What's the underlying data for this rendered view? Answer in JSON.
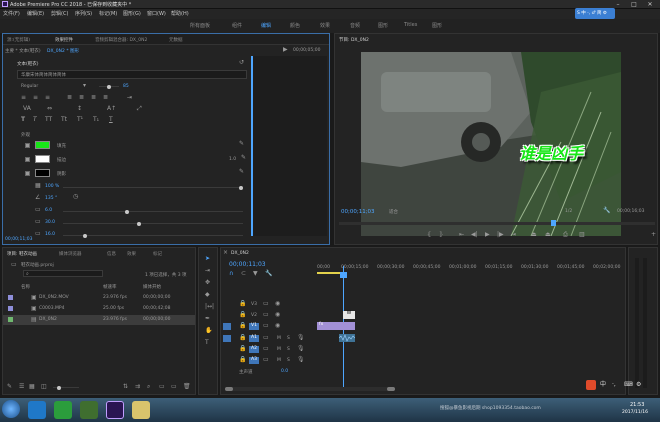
{
  "app": {
    "title": "Adobe Premiere Pro CC 2018 - 已保存到收藏夹中 *"
  },
  "menu": [
    "文件(F)",
    "编辑(E)",
    "剪辑(C)",
    "序列(S)",
    "标记(M)",
    "图形(G)",
    "窗口(W)",
    "帮助(H)"
  ],
  "workspaces": [
    "所有面板",
    "组件",
    "编辑",
    "颜色",
    "效果",
    "音频",
    "图形",
    "Titles",
    "图形"
  ],
  "effect_controls": {
    "tabs": [
      "源:(无剪辑)",
      "效果控件",
      "音频剪辑混合器: DX_0N2",
      "元数据"
    ],
    "master_label": "主要 * 文本(鞋衣)",
    "clip_label": "DX_0N2 * 图形",
    "time": "00;00;05;00",
    "text_section": "文本(鞋衣)",
    "font_name": "华康宋体简体简体简体",
    "font_style": "Regular",
    "font_size": "85",
    "appearance_label": "外观",
    "fill_label": "填充",
    "stroke_label": "描边",
    "shadow_label": "阴影",
    "stroke_value": "1.0",
    "shadow_values": [
      "100 %",
      "135 °",
      "6.0",
      "30.0",
      "16.0"
    ],
    "timecode": "00;00;11;03",
    "fill_color": "#17e617",
    "stroke_color": "#ffffff",
    "shadow_color": "#000000"
  },
  "program_monitor": {
    "title": "节目: DX_0N2",
    "timecode_left": "00;00;11;03",
    "fit_label": "适合",
    "ratio_label": "1/2",
    "timecode_right": "00;00;16;03",
    "overlay_text": "谁是凶手"
  },
  "project": {
    "tabs": [
      "项目: 鞋衣动画",
      "媒体浏览器",
      "信息",
      "效果",
      "标记"
    ],
    "path": "鞋衣动画.prproj",
    "items_count": "1 项已选择，共 3 项",
    "columns": [
      "名称",
      "帧速率",
      "媒体开始"
    ],
    "items": [
      {
        "name": "DX_0N2.MOV",
        "fps": "23.976 fps",
        "start": "00;00;00;00",
        "color": "#8e8ed9"
      },
      {
        "name": "C0003.MP4",
        "fps": "25.00 fps",
        "start": "00;00;42;08",
        "color": "#8e8ed9"
      },
      {
        "name": "DX_0N2",
        "fps": "23.976 fps",
        "start": "00;00;00;00",
        "color": "#6fb86f"
      }
    ]
  },
  "timeline": {
    "title": "DX_0N2",
    "timecode": "00;00;11;03",
    "ruler": [
      "00;00",
      "00;00;15;00",
      "00;00;30;00",
      "00;00;45;00",
      "00;01;00;00",
      "00;01;15;00",
      "00;01;30;00",
      "00;01;45;00",
      "00;02;00;00"
    ],
    "video_tracks": [
      "V3",
      "V2",
      "V1"
    ],
    "audio_tracks": [
      "A1",
      "A2",
      "A3"
    ],
    "master_label": "主声道",
    "master_value": "0.0",
    "clip_v1_label": "fx",
    "clip_v2_label": "W"
  },
  "taskbar": {
    "clock_time": "21:53",
    "clock_date": "2017/11/16",
    "watermark": "搜狐@暴鱼影视后期 shop1093354.taobao.com"
  },
  "ime_badge": "S 中 ·, ♂ 简 ⚙"
}
